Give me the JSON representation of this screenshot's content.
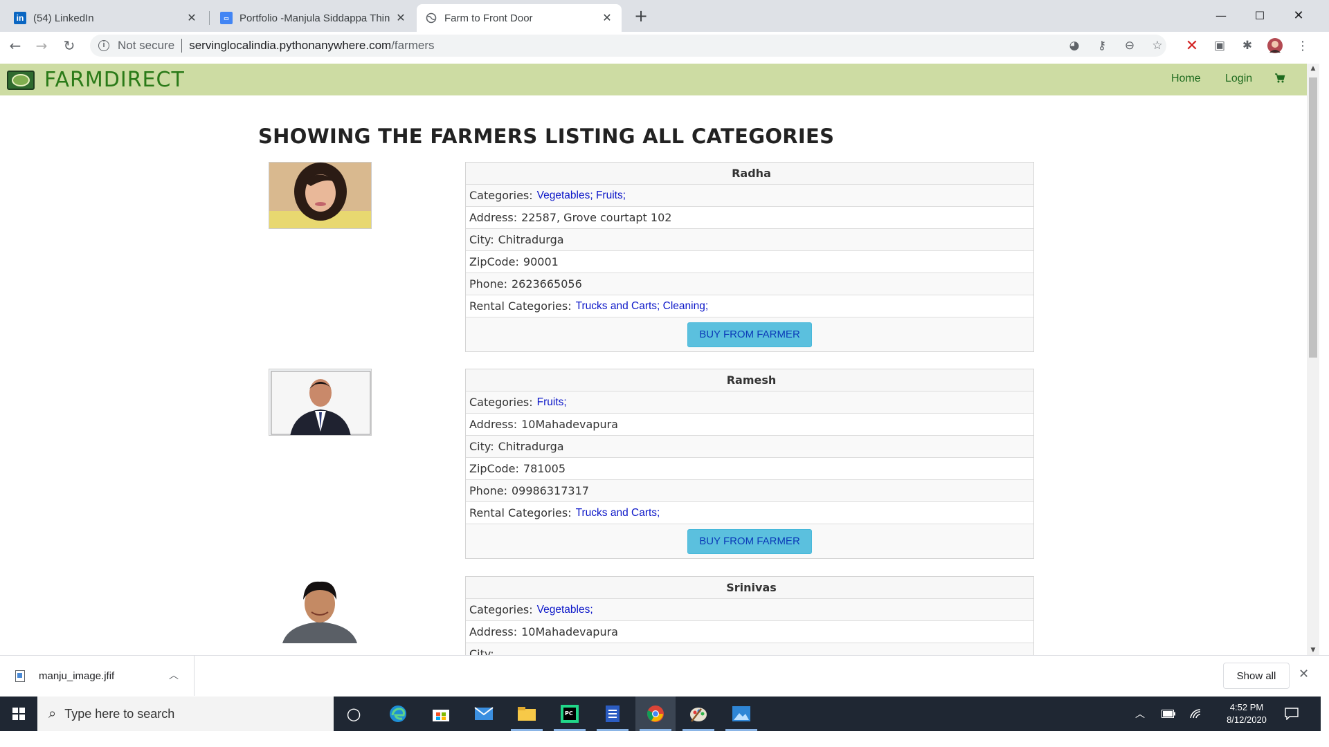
{
  "tabs": [
    {
      "title": "(54) LinkedIn",
      "icon": "linkedin-icon",
      "active": false
    },
    {
      "title": "Portfolio -Manjula Siddappa Thin",
      "icon": "google-sites-icon",
      "active": false
    },
    {
      "title": "Farm to Front Door",
      "icon": "globe-icon",
      "active": true
    }
  ],
  "address_bar": {
    "security_label": "Not secure",
    "url_host": "servinglocalindia.pythonanywhere.com",
    "url_path": "/farmers"
  },
  "site": {
    "brand": "FARMDIRECT",
    "nav": {
      "home": "Home",
      "login": "Login"
    }
  },
  "page": {
    "heading": "SHOWING THE FARMERS LISTING ALL CATEGORIES"
  },
  "labels": {
    "categories": "Categories:",
    "address": "Address:",
    "city": "City:",
    "zipcode": "ZipCode:",
    "phone": "Phone:",
    "rental": "Rental Categories:",
    "buy_button": "BUY FROM FARMER"
  },
  "farmers": [
    {
      "name": "Radha",
      "categories": "Vegetables; Fruits;",
      "address": "22587, Grove courtapt 102",
      "city": "Chitradurga",
      "zipcode": "90001",
      "phone": "2623665056",
      "rental": "Trucks and Carts; Cleaning;"
    },
    {
      "name": "Ramesh",
      "categories": "Fruits;",
      "address": "10Mahadevapura",
      "city": "Chitradurga",
      "zipcode": "781005",
      "phone": "09986317317",
      "rental": "Trucks and Carts;"
    },
    {
      "name": "Srinivas",
      "categories": "Vegetables;",
      "address": "10Mahadevapura"
    }
  ],
  "download_shelf": {
    "file_name": "manju_image.jfif",
    "show_all": "Show all"
  },
  "taskbar": {
    "search_placeholder": "Type here to search",
    "time": "4:52 PM",
    "date": "8/12/2020"
  },
  "colors": {
    "nav_bg": "#cddca3",
    "brand": "#2a7a18",
    "link": "#0a15c8",
    "button": "#5bc0de"
  }
}
